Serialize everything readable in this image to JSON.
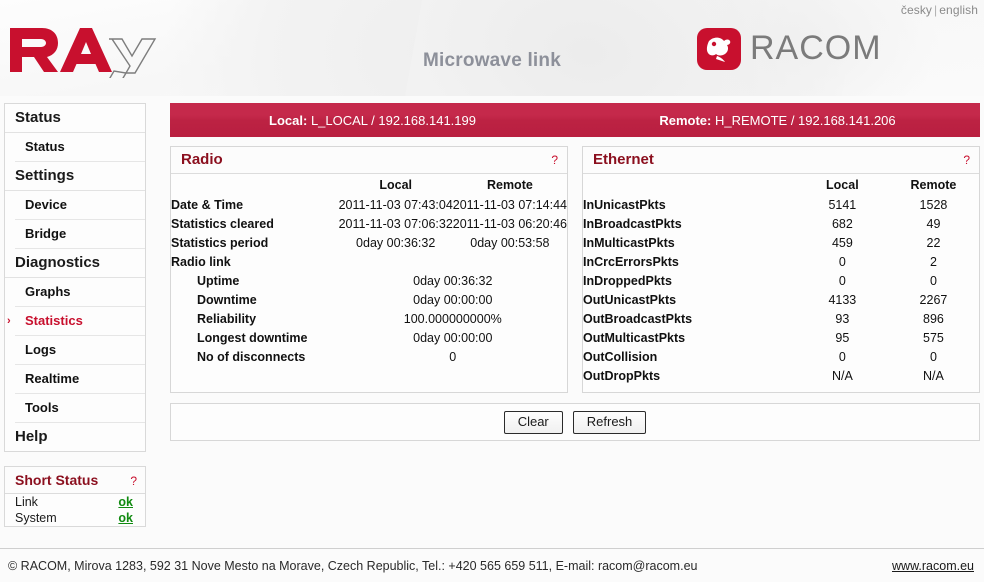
{
  "header": {
    "logo_text": "RAy",
    "title": "Microwave link",
    "lang_cesky": "česky",
    "lang_sep": "|",
    "lang_english": "english",
    "brand": "RACOM"
  },
  "sidebar": {
    "groups": [
      {
        "section": "Status",
        "items": [
          {
            "label": "Status",
            "active": false
          }
        ]
      },
      {
        "section": "Settings",
        "items": [
          {
            "label": "Device",
            "active": false
          },
          {
            "label": "Bridge",
            "active": false
          }
        ]
      },
      {
        "section": "Diagnostics",
        "items": [
          {
            "label": "Graphs",
            "active": false
          },
          {
            "label": "Statistics",
            "active": true
          },
          {
            "label": "Logs",
            "active": false
          },
          {
            "label": "Realtime",
            "active": false
          },
          {
            "label": "Tools",
            "active": false
          }
        ]
      },
      {
        "section": "Help",
        "items": []
      }
    ],
    "arrow_glyph": "›"
  },
  "short_status": {
    "title": "Short Status",
    "help": "?",
    "rows": [
      {
        "label": "Link",
        "value": "ok"
      },
      {
        "label": "System",
        "value": "ok"
      }
    ]
  },
  "link_bar": {
    "local_label": "Local:",
    "local_value": "L_LOCAL / 192.168.141.199",
    "remote_label": "Remote:",
    "remote_value": "H_REMOTE / 192.168.141.206"
  },
  "radio_panel": {
    "title": "Radio",
    "help": "?",
    "col_local": "Local",
    "col_remote": "Remote",
    "rows": [
      {
        "label": "Date & Time",
        "indent": false,
        "span": false,
        "local": "2011-11-03 07:43:04",
        "remote": "2011-11-03 07:14:44"
      },
      {
        "label": "Statistics cleared",
        "indent": false,
        "span": false,
        "local": "2011-11-03 07:06:32",
        "remote": "2011-11-03 06:20:46"
      },
      {
        "label": "Statistics period",
        "indent": false,
        "span": false,
        "local": "0day 00:36:32",
        "remote": "0day 00:53:58"
      },
      {
        "label": "Radio link",
        "indent": false,
        "span": false,
        "local": "",
        "remote": ""
      },
      {
        "label": "Uptime",
        "indent": true,
        "span": true,
        "value": "0day 00:36:32"
      },
      {
        "label": "Downtime",
        "indent": true,
        "span": true,
        "value": "0day 00:00:00"
      },
      {
        "label": "Reliability",
        "indent": true,
        "span": true,
        "value": "100.000000000%"
      },
      {
        "label": "Longest downtime",
        "indent": true,
        "span": true,
        "value": "0day 00:00:00"
      },
      {
        "label": "No of disconnects",
        "indent": true,
        "span": true,
        "value": "0"
      }
    ]
  },
  "ethernet_panel": {
    "title": "Ethernet",
    "help": "?",
    "col_local": "Local",
    "col_remote": "Remote",
    "rows": [
      {
        "label": "InUnicastPkts",
        "local": "5141",
        "remote": "1528"
      },
      {
        "label": "InBroadcastPkts",
        "local": "682",
        "remote": "49"
      },
      {
        "label": "InMulticastPkts",
        "local": "459",
        "remote": "22"
      },
      {
        "label": "InCrcErrorsPkts",
        "local": "0",
        "remote": "2"
      },
      {
        "label": "InDroppedPkts",
        "local": "0",
        "remote": "0"
      },
      {
        "label": "OutUnicastPkts",
        "local": "4133",
        "remote": "2267"
      },
      {
        "label": "OutBroadcastPkts",
        "local": "93",
        "remote": "896"
      },
      {
        "label": "OutMulticastPkts",
        "local": "95",
        "remote": "575"
      },
      {
        "label": "OutCollision",
        "local": "0",
        "remote": "0"
      },
      {
        "label": "OutDropPkts",
        "local": "N/A",
        "remote": "N/A"
      }
    ]
  },
  "actions": {
    "clear_label": "Clear",
    "refresh_label": "Refresh"
  },
  "footer": {
    "text": "© RACOM, Mirova 1283, 592 31 Nove Mesto na Morave, Czech Republic, Tel.: +420 565 659 511, E-mail: racom@racom.eu",
    "link": "www.racom.eu"
  },
  "colors": {
    "brand_red": "#c8102e",
    "panel_title_red": "#8b0f1e",
    "link_bar_red": "#c5294b",
    "status_ok_green": "#108a10",
    "title_gray": "#8d909a"
  }
}
